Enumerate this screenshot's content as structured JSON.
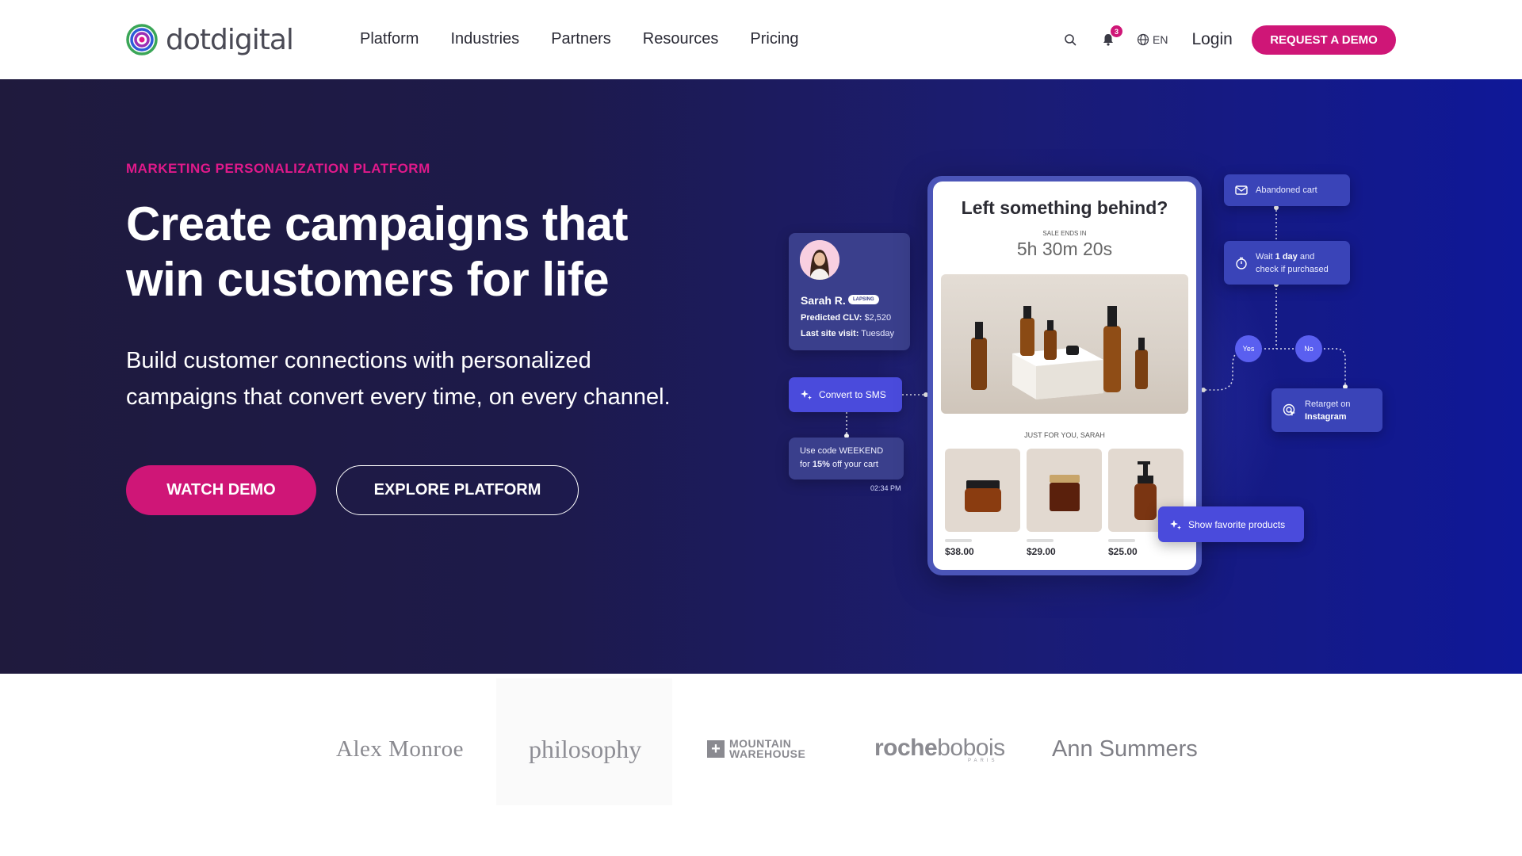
{
  "nav": {
    "logo_text": "dotdigital",
    "menu": [
      "Platform",
      "Industries",
      "Partners",
      "Resources",
      "Pricing"
    ],
    "notification_count": "3",
    "language": "EN",
    "login_label": "Login",
    "demo_label": "REQUEST A DEMO"
  },
  "hero": {
    "eyebrow": "MARKETING PERSONALIZATION PLATFORM",
    "headline_line1": "Create campaigns that",
    "headline_line2": "win customers for life",
    "subtitle_line1": "Build customer connections with personalized",
    "subtitle_line2": "campaigns that convert every time, on every channel.",
    "watch_label": "WATCH DEMO",
    "explore_label": "EXPLORE PLATFORM"
  },
  "illustration": {
    "profile": {
      "name": "Sarah R.",
      "badge": "LAPSING",
      "clv_label": "Predicted CLV:",
      "clv_value": "$2,520",
      "visit_label": "Last site visit:",
      "visit_value": "Tuesday"
    },
    "sms_chip": "Convert to SMS",
    "sms_message_line1": "Use code WEEKEND",
    "sms_message_pre": "for ",
    "sms_message_bold": "15%",
    "sms_message_post": " off your cart",
    "sms_time": "02:34 PM",
    "phone": {
      "title": "Left something behind?",
      "sale_label": "SALE ENDS IN",
      "timer": "5h 30m 20s",
      "just_for_you": "JUST FOR YOU, SARAH",
      "prices": [
        "$38.00",
        "$29.00",
        "$25.00"
      ]
    },
    "flow": {
      "abandoned_cart": "Abandoned cart",
      "wait_pre": "Wait ",
      "wait_bold": "1 day",
      "wait_post": " and",
      "wait_line2": "check if purchased",
      "yes": "Yes",
      "no": "No",
      "retarget_line1": "Retarget on",
      "retarget_line2": "Instagram"
    },
    "favorite_chip": "Show favorite products"
  },
  "brands": {
    "alex": "Alex Monroe",
    "philosophy": "philosophy",
    "mw_line1": "MOUNTAIN",
    "mw_line2": "WAREHOUSE",
    "roche_bold": "roche",
    "roche_light": "bobois",
    "roche_sub": "PARIS",
    "ann": "Ann Summers"
  },
  "colors": {
    "accent": "#cf1677",
    "hero_dark": "#1f1a3d",
    "hero_blue": "#0f1898",
    "chip": "#4a4bdc"
  }
}
